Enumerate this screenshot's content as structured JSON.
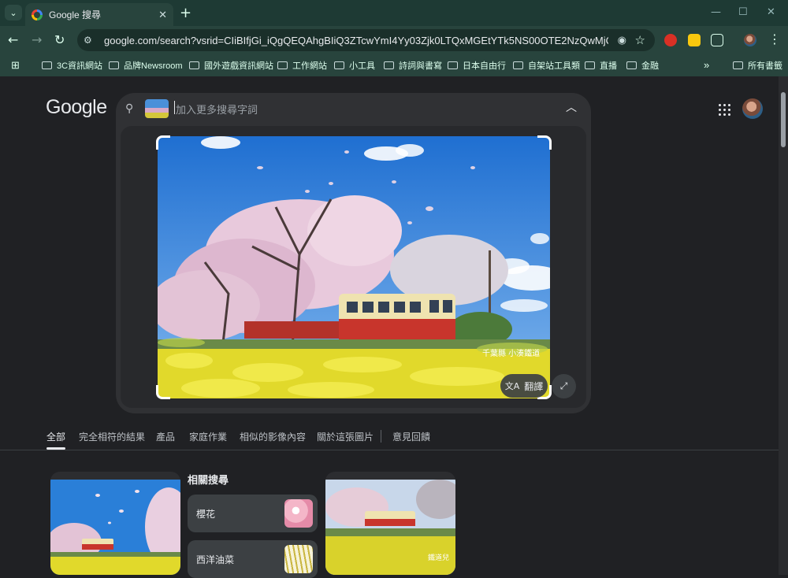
{
  "browser": {
    "tab_title": "Google 搜尋",
    "url": "google.com/search?vsrid=CIiBIfjGi_iQgQEQAhgBIiQ3ZTcwYmI4Yy03Zjk0LTQxMGEtYTk5NS00OTE2NzQwMjQ3NzMyBiIC...",
    "bookmarks": [
      "3C資訊網站",
      "品牌Newsroom",
      "國外遊戲資訊網站",
      "工作網站",
      "小工具",
      "詩詞與書寫",
      "日本自由行",
      "自架站工具類",
      "直播",
      "金融"
    ],
    "bookmarks_overflow": "»",
    "all_bookmarks": "所有書籤"
  },
  "page": {
    "logo": "Google",
    "search_placeholder": "加入更多搜尋字詞",
    "image_watermark": "千葉縣 小湊鐵道",
    "translate_label": "翻譯",
    "filters": [
      "全部",
      "完全相符的結果",
      "產品",
      "家庭作業",
      "相似的影像內容",
      "關於這張圖片",
      "意見回饋"
    ],
    "related_title": "相關搜尋",
    "related": [
      {
        "label": "櫻花"
      },
      {
        "label": "西洋油菜"
      }
    ],
    "result_watermark": "鐵道兒"
  },
  "colors": {
    "titlebar": "#1e3a34",
    "toolbar": "#28443d",
    "page_bg": "#202124",
    "surface": "#303134"
  }
}
